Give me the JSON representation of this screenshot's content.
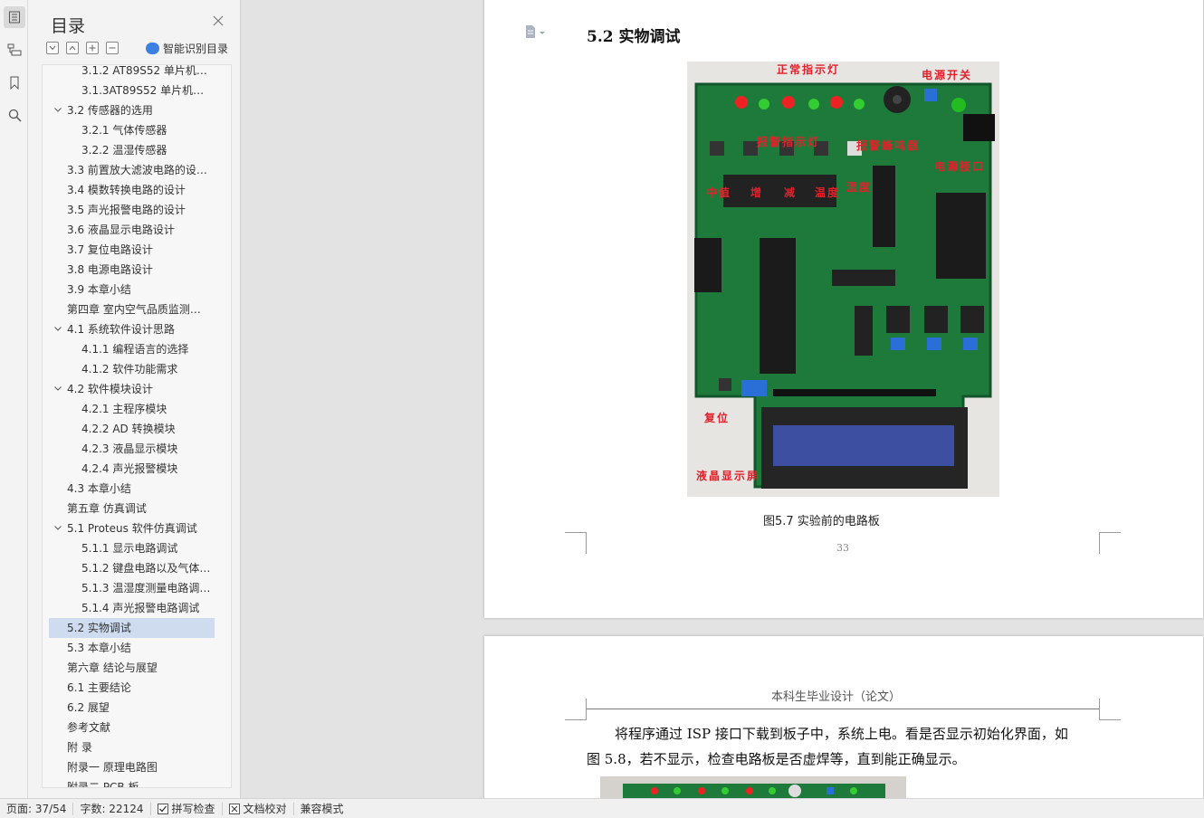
{
  "toc": {
    "title": "目录",
    "smart_label": "智能识别目录",
    "items": [
      {
        "label": "3.1.2 AT89S52 单片机…",
        "level": 3,
        "expand": false
      },
      {
        "label": "3.1.3AT89S52 单片机…",
        "level": 3,
        "expand": false
      },
      {
        "label": "3.2 传感器的选用",
        "level": 2,
        "expand": true
      },
      {
        "label": "3.2.1 气体传感器",
        "level": 3,
        "expand": false
      },
      {
        "label": "3.2.2 温湿传感器",
        "level": 3,
        "expand": false
      },
      {
        "label": "3.3 前置放大滤波电路的设…",
        "level": 2,
        "expand": false
      },
      {
        "label": "3.4 模数转换电路的设计",
        "level": 2,
        "expand": false
      },
      {
        "label": "3.5 声光报警电路的设计",
        "level": 2,
        "expand": false
      },
      {
        "label": "3.6 液晶显示电路设计",
        "level": 2,
        "expand": false
      },
      {
        "label": "3.7 复位电路设计",
        "level": 2,
        "expand": false
      },
      {
        "label": "3.8 电源电路设计",
        "level": 2,
        "expand": false
      },
      {
        "label": "3.9 本章小结",
        "level": 2,
        "expand": false
      },
      {
        "label": "第四章 室内空气品质监测…",
        "level": 1,
        "expand": false
      },
      {
        "label": "4.1 系统软件设计思路",
        "level": 2,
        "expand": true
      },
      {
        "label": "4.1.1 编程语言的选择",
        "level": 3,
        "expand": false
      },
      {
        "label": "4.1.2 软件功能需求",
        "level": 3,
        "expand": false
      },
      {
        "label": "4.2 软件模块设计",
        "level": 2,
        "expand": true
      },
      {
        "label": "4.2.1 主程序模块",
        "level": 3,
        "expand": false
      },
      {
        "label": "4.2.2 AD 转换模块",
        "level": 3,
        "expand": false
      },
      {
        "label": "4.2.3 液晶显示模块",
        "level": 3,
        "expand": false
      },
      {
        "label": "4.2.4 声光报警模块",
        "level": 3,
        "expand": false
      },
      {
        "label": "4.3 本章小结",
        "level": 2,
        "expand": false
      },
      {
        "label": "第五章 仿真调试",
        "level": 1,
        "expand": false
      },
      {
        "label": "5.1 Proteus 软件仿真调试",
        "level": 2,
        "expand": true
      },
      {
        "label": "5.1.1 显示电路调试",
        "level": 3,
        "expand": false
      },
      {
        "label": "5.1.2 键盘电路以及气体…",
        "level": 3,
        "expand": false
      },
      {
        "label": "5.1.3 温湿度测量电路调…",
        "level": 3,
        "expand": false
      },
      {
        "label": "5.1.4 声光报警电路调试",
        "level": 3,
        "expand": false
      },
      {
        "label": "5.2 实物调试",
        "level": 2,
        "expand": false,
        "selected": true
      },
      {
        "label": "5.3 本章小结",
        "level": 2,
        "expand": false
      },
      {
        "label": "第六章 结论与展望",
        "level": 1,
        "expand": false
      },
      {
        "label": "6.1 主要结论",
        "level": 2,
        "expand": false
      },
      {
        "label": "6.2 展望",
        "level": 2,
        "expand": false
      },
      {
        "label": "参考文献",
        "level": 1,
        "expand": false
      },
      {
        "label": "附 录",
        "level": 1,
        "expand": false
      },
      {
        "label": "附录一 原理电路图",
        "level": 1,
        "expand": false
      },
      {
        "label": "附录二 PCB 板",
        "level": 1,
        "expand": false
      }
    ]
  },
  "page1": {
    "section_title": "5.2  实物调试",
    "photo_labels": {
      "normal_led": "正常指示灯",
      "power_switch": "电源开关",
      "alarm_led": "报警指示灯",
      "buzzer": "报警蜂鸣器",
      "power_port": "电源接口",
      "key_mid": "中值",
      "key_plus": "增",
      "key_minus": "减",
      "key_temp": "温度",
      "key_hum": "湿度",
      "reset": "复位",
      "lcd": "液晶显示屏"
    },
    "caption": "图5.7  实验前的电路板",
    "page_number": "33"
  },
  "page2": {
    "header": "本科生毕业设计（论文）",
    "line1": "将程序通过 ISP 接口下载到板子中，系统上电。看是否显示初始化界面，如",
    "line2": "图 5.8，若不显示，检查电路板是否虚焊等，直到能正确显示。"
  },
  "status": {
    "page": "页面: 37/54",
    "words": "字数: 22124",
    "spell": "拼写检查",
    "proof": "文档校对",
    "compat": "兼容模式"
  }
}
